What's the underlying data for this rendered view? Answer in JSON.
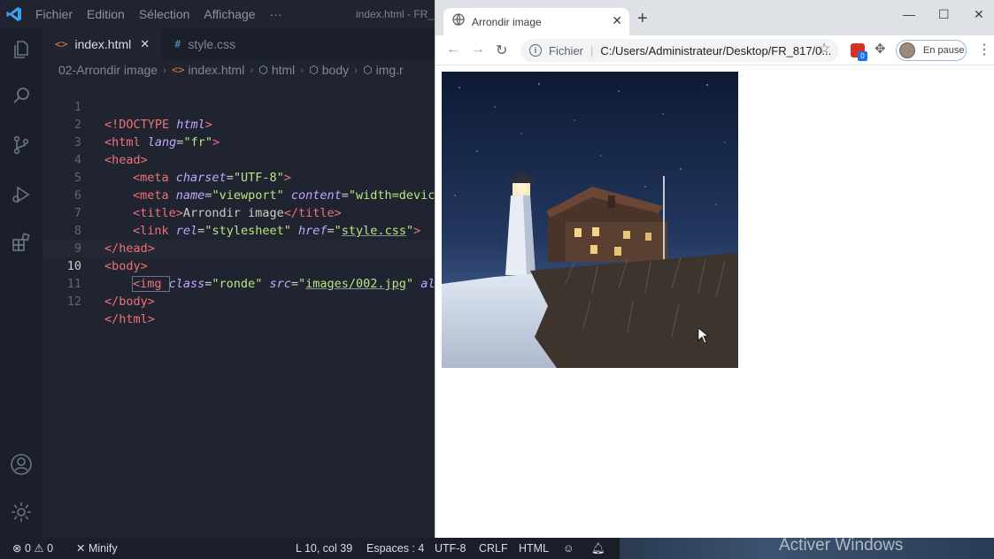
{
  "vscode": {
    "menu": [
      "Fichier",
      "Edition",
      "Sélection",
      "Affichage",
      "···"
    ],
    "window_title": "index.html - FR_",
    "tabs": [
      {
        "label": "index.html",
        "active": true
      },
      {
        "label": "style.css",
        "active": false
      }
    ],
    "breadcrumbs": [
      "02-Arrondir image",
      "index.html",
      "html",
      "body",
      "img.r"
    ],
    "line_numbers": [
      "1",
      "2",
      "3",
      "4",
      "5",
      "6",
      "7",
      "8",
      "9",
      "10",
      "11",
      "12"
    ],
    "current_line": "10",
    "code": {
      "l1_a": "<!DOCTYPE ",
      "l1_b": "html",
      "l1_c": ">",
      "l2_a": "<html ",
      "l2_b": "lang",
      "l2_c": "=",
      "l2_d": "\"fr\"",
      "l2_e": ">",
      "l3": "<head>",
      "l4_a": "<meta ",
      "l4_b": "charset",
      "l4_c": "=",
      "l4_d": "\"UTF-8\"",
      "l4_e": ">",
      "l5_a": "<meta ",
      "l5_b": "name",
      "l5_c": "=",
      "l5_d": "\"viewport\"",
      "l5_e": " ",
      "l5_f": "content",
      "l5_g": "=",
      "l5_h": "\"width=devic",
      "l6_a": "<title>",
      "l6_b": "Arrondir image",
      "l6_c": "</title>",
      "l7_a": "<link ",
      "l7_b": "rel",
      "l7_c": "=",
      "l7_d": "\"stylesheet\"",
      "l7_e": " ",
      "l7_f": "href",
      "l7_g": "=",
      "l7_h": "\"",
      "l7_i": "style.css",
      "l7_j": "\"",
      "l7_k": ">",
      "l8": "</head>",
      "l9": "<body>",
      "l10_a": "<img ",
      "l10_b": "class",
      "l10_c": "=",
      "l10_d": "\"ronde\"",
      "l10_e": " ",
      "l10_f": "src",
      "l10_g": "=",
      "l10_h": "\"",
      "l10_i": "images/002.jpg",
      "l10_j": "\"",
      "l10_k": " ",
      "l10_l": "al",
      "l11": "</body>",
      "l12": "</html>"
    },
    "status": {
      "errors": "0",
      "warnings": "0",
      "minify": "Minify",
      "position": "L 10, col 39",
      "spaces": "Espaces : 4",
      "encoding": "UTF-8",
      "eol": "CRLF",
      "language": "HTML"
    },
    "watermark": "Activer Windows"
  },
  "browser": {
    "tab_title": "Arrondir image",
    "omnibox_label": "Fichier",
    "url": "C:/Users/Administrateur/Desktop/FR_817/0...",
    "extension_badge": "0",
    "profile_status": "En pause"
  },
  "colors": {
    "editor_bg": "#1f2430",
    "accent_blue": "#1a73e8"
  }
}
